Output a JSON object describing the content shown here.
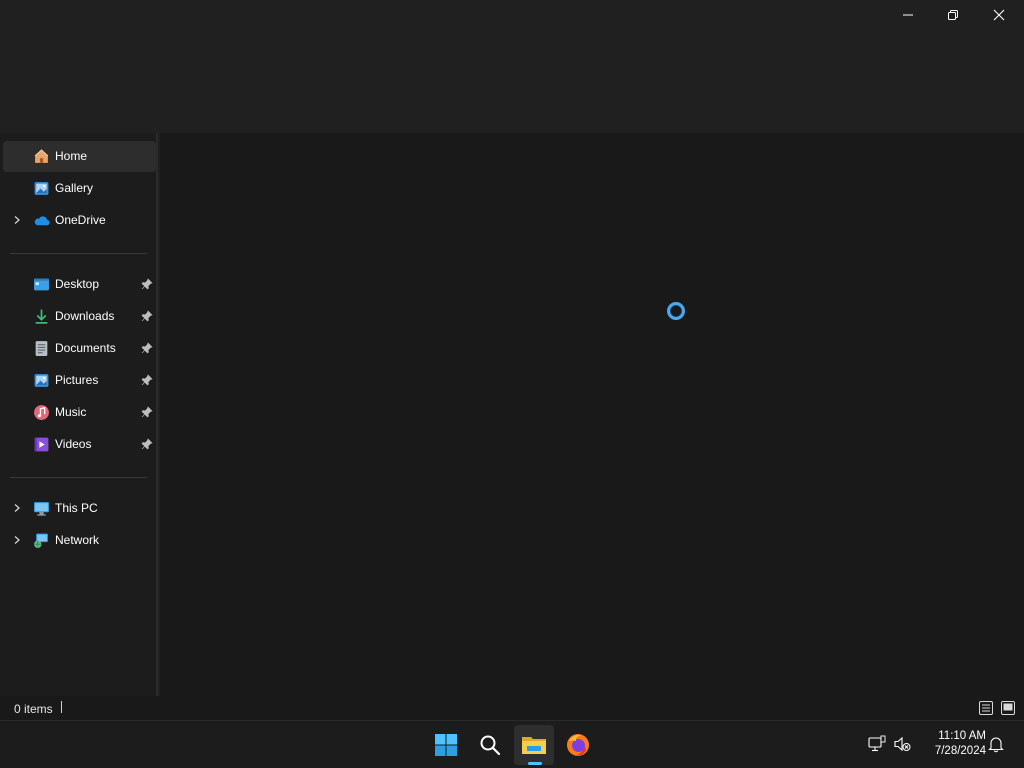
{
  "sidebar": {
    "items": [
      {
        "label": "Home",
        "icon": "home-icon",
        "selected": true
      },
      {
        "label": "Gallery",
        "icon": "gallery-icon"
      },
      {
        "label": "OneDrive",
        "icon": "onedrive-icon",
        "expandable": true
      }
    ],
    "quick_access": [
      {
        "label": "Desktop",
        "icon": "desktop-icon",
        "pinned": true
      },
      {
        "label": "Downloads",
        "icon": "downloads-icon",
        "pinned": true
      },
      {
        "label": "Documents",
        "icon": "documents-icon",
        "pinned": true
      },
      {
        "label": "Pictures",
        "icon": "pictures-icon",
        "pinned": true
      },
      {
        "label": "Music",
        "icon": "music-icon",
        "pinned": true
      },
      {
        "label": "Videos",
        "icon": "videos-icon",
        "pinned": true
      }
    ],
    "devices": [
      {
        "label": "This PC",
        "icon": "this-pc-icon",
        "expandable": true
      },
      {
        "label": "Network",
        "icon": "network-icon",
        "expandable": true
      }
    ]
  },
  "content": {
    "state": "loading"
  },
  "statusbar": {
    "item_count": "0 items"
  },
  "taskbar": {
    "apps": [
      "start-icon",
      "search-icon",
      "file-explorer-icon",
      "firefox-icon"
    ],
    "active_app": "file-explorer-icon",
    "time": "11:10 AM",
    "date": "7/28/2024"
  },
  "colors": {
    "background": "#202020",
    "content": "#191919",
    "selected": "#2d2d2d",
    "accent": "#4cc2ff"
  }
}
